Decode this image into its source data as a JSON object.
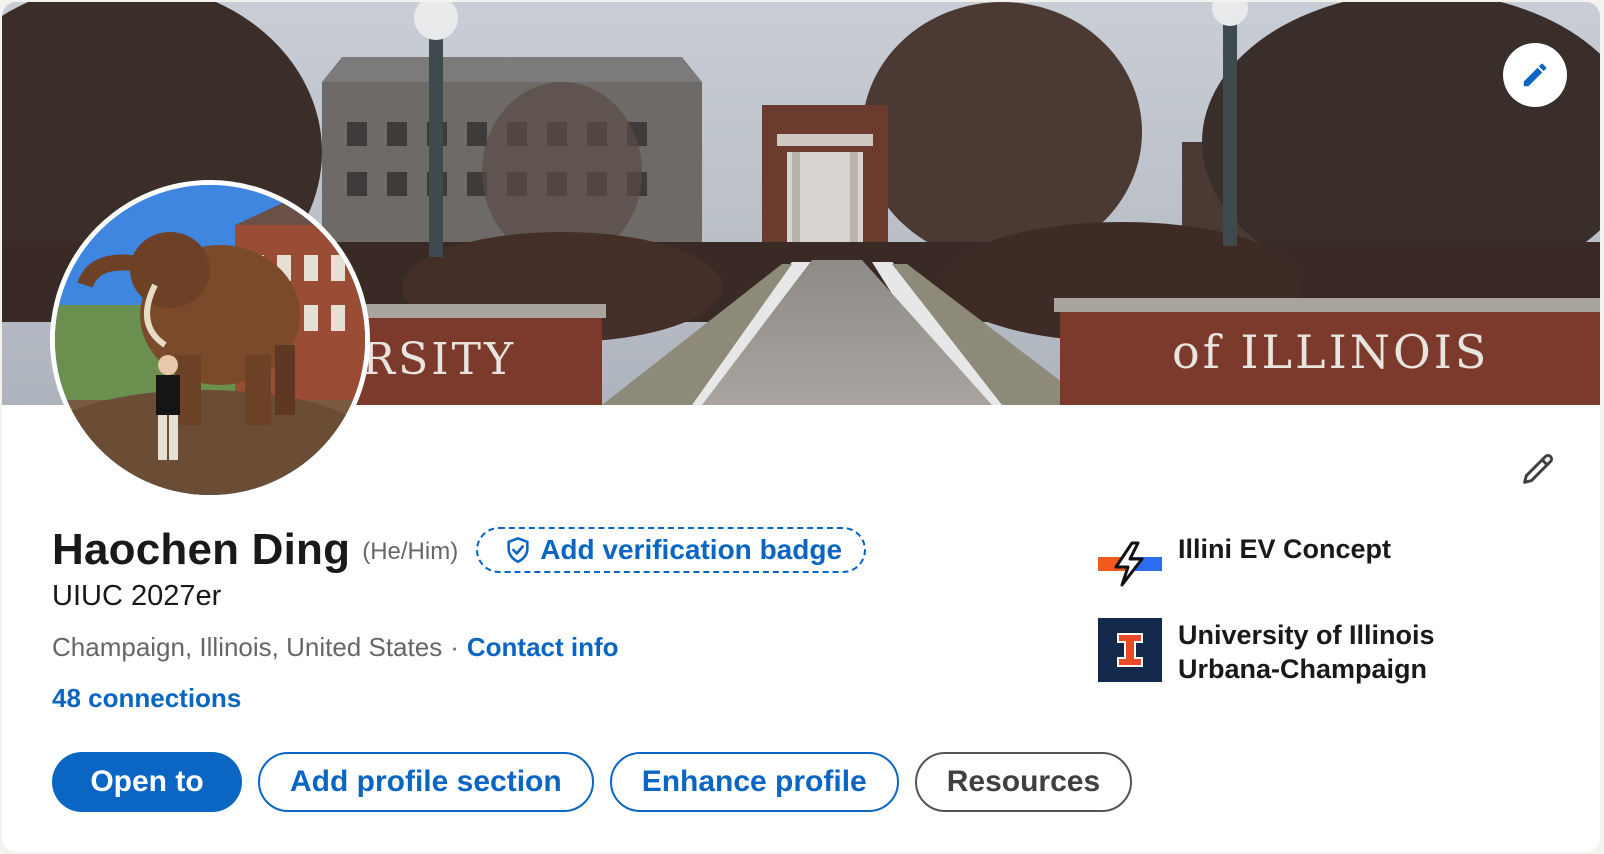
{
  "profile": {
    "name": "Haochen Ding",
    "pronouns": "(He/Him)",
    "verification_label": "Add verification badge",
    "headline": "UIUC 2027er",
    "location": "Champaign, Illinois, United States",
    "separator": "·",
    "contact_label": "Contact info",
    "connections_label": "48 connections"
  },
  "banner": {
    "sign_left": "RSITY",
    "sign_right": "of ILLINOIS"
  },
  "organizations": [
    {
      "name": "Illini EV Concept",
      "logo": "lightning-bolt-logo"
    },
    {
      "name_line1": "University of Illinois",
      "name_line2": "Urbana-Champaign",
      "logo": "block-i-logo"
    }
  ],
  "actions": {
    "open_to": "Open to",
    "add_section": "Add profile section",
    "enhance": "Enhance profile",
    "resources": "Resources"
  },
  "colors": {
    "brand_blue": "#0a66c2",
    "illinois_orange": "#e84a27",
    "illinois_navy": "#13294b"
  }
}
